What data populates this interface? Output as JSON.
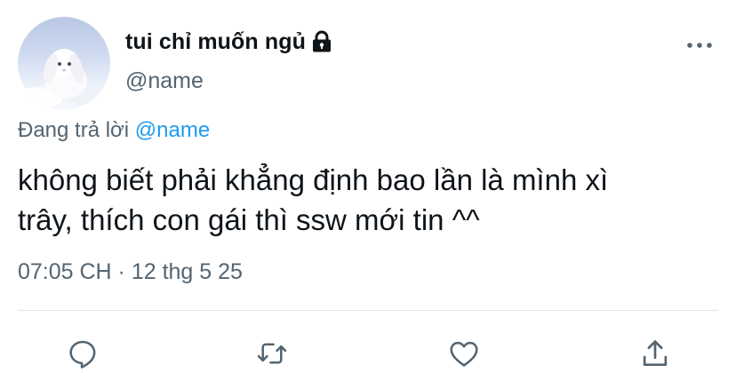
{
  "author": {
    "display_name": "tui chỉ muốn ngủ",
    "handle": "@name",
    "protected": true
  },
  "reply_context": {
    "prefix": "Đang trả lời",
    "mention": "@name"
  },
  "tweet": {
    "text_lines": [
      "không biết phải khẳng định bao lần là mình xì",
      "trây, thích con gái thì ssw mới tin ^^"
    ],
    "timestamp": "07:05 CH · 12 thg 5 25"
  },
  "icons": {
    "more": "more-horizontal-icon",
    "lock": "lock-icon",
    "reply": "reply-icon",
    "retweet": "retweet-icon",
    "like": "heart-icon",
    "share": "share-icon"
  },
  "colors": {
    "text": "#0f1419",
    "secondary": "#536471",
    "accent": "#1d9bf0",
    "divider": "#e1e6ea"
  }
}
